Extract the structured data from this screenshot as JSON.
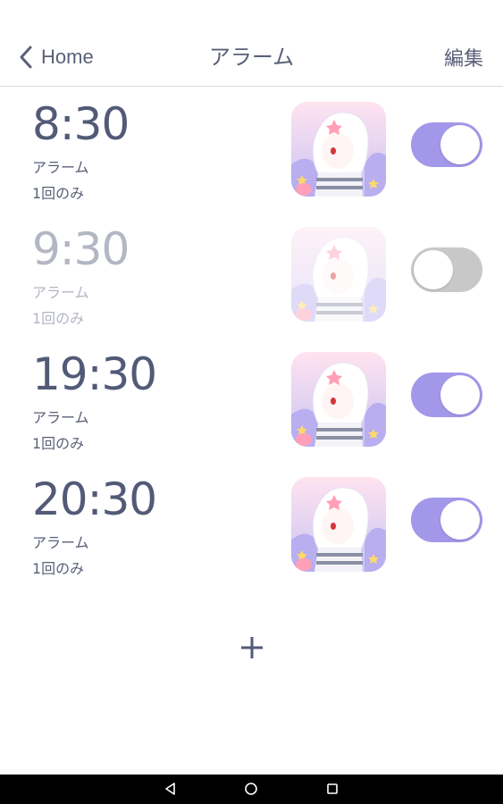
{
  "header": {
    "back_label": "Home",
    "title": "アラーム",
    "edit_label": "編集"
  },
  "alarms": [
    {
      "time": "8:30",
      "label": "アラーム",
      "repeat": "1回のみ",
      "enabled": true
    },
    {
      "time": "9:30",
      "label": "アラーム",
      "repeat": "1回のみ",
      "enabled": false
    },
    {
      "time": "19:30",
      "label": "アラーム",
      "repeat": "1回のみ",
      "enabled": true
    },
    {
      "time": "20:30",
      "label": "アラーム",
      "repeat": "1回のみ",
      "enabled": true
    }
  ],
  "add_button": {
    "icon": "plus-icon"
  },
  "colors": {
    "accent": "#a397e9",
    "toggle_off": "#c8c8c8",
    "text": "#5a6078",
    "disabled_text": "#b3b6c3"
  }
}
